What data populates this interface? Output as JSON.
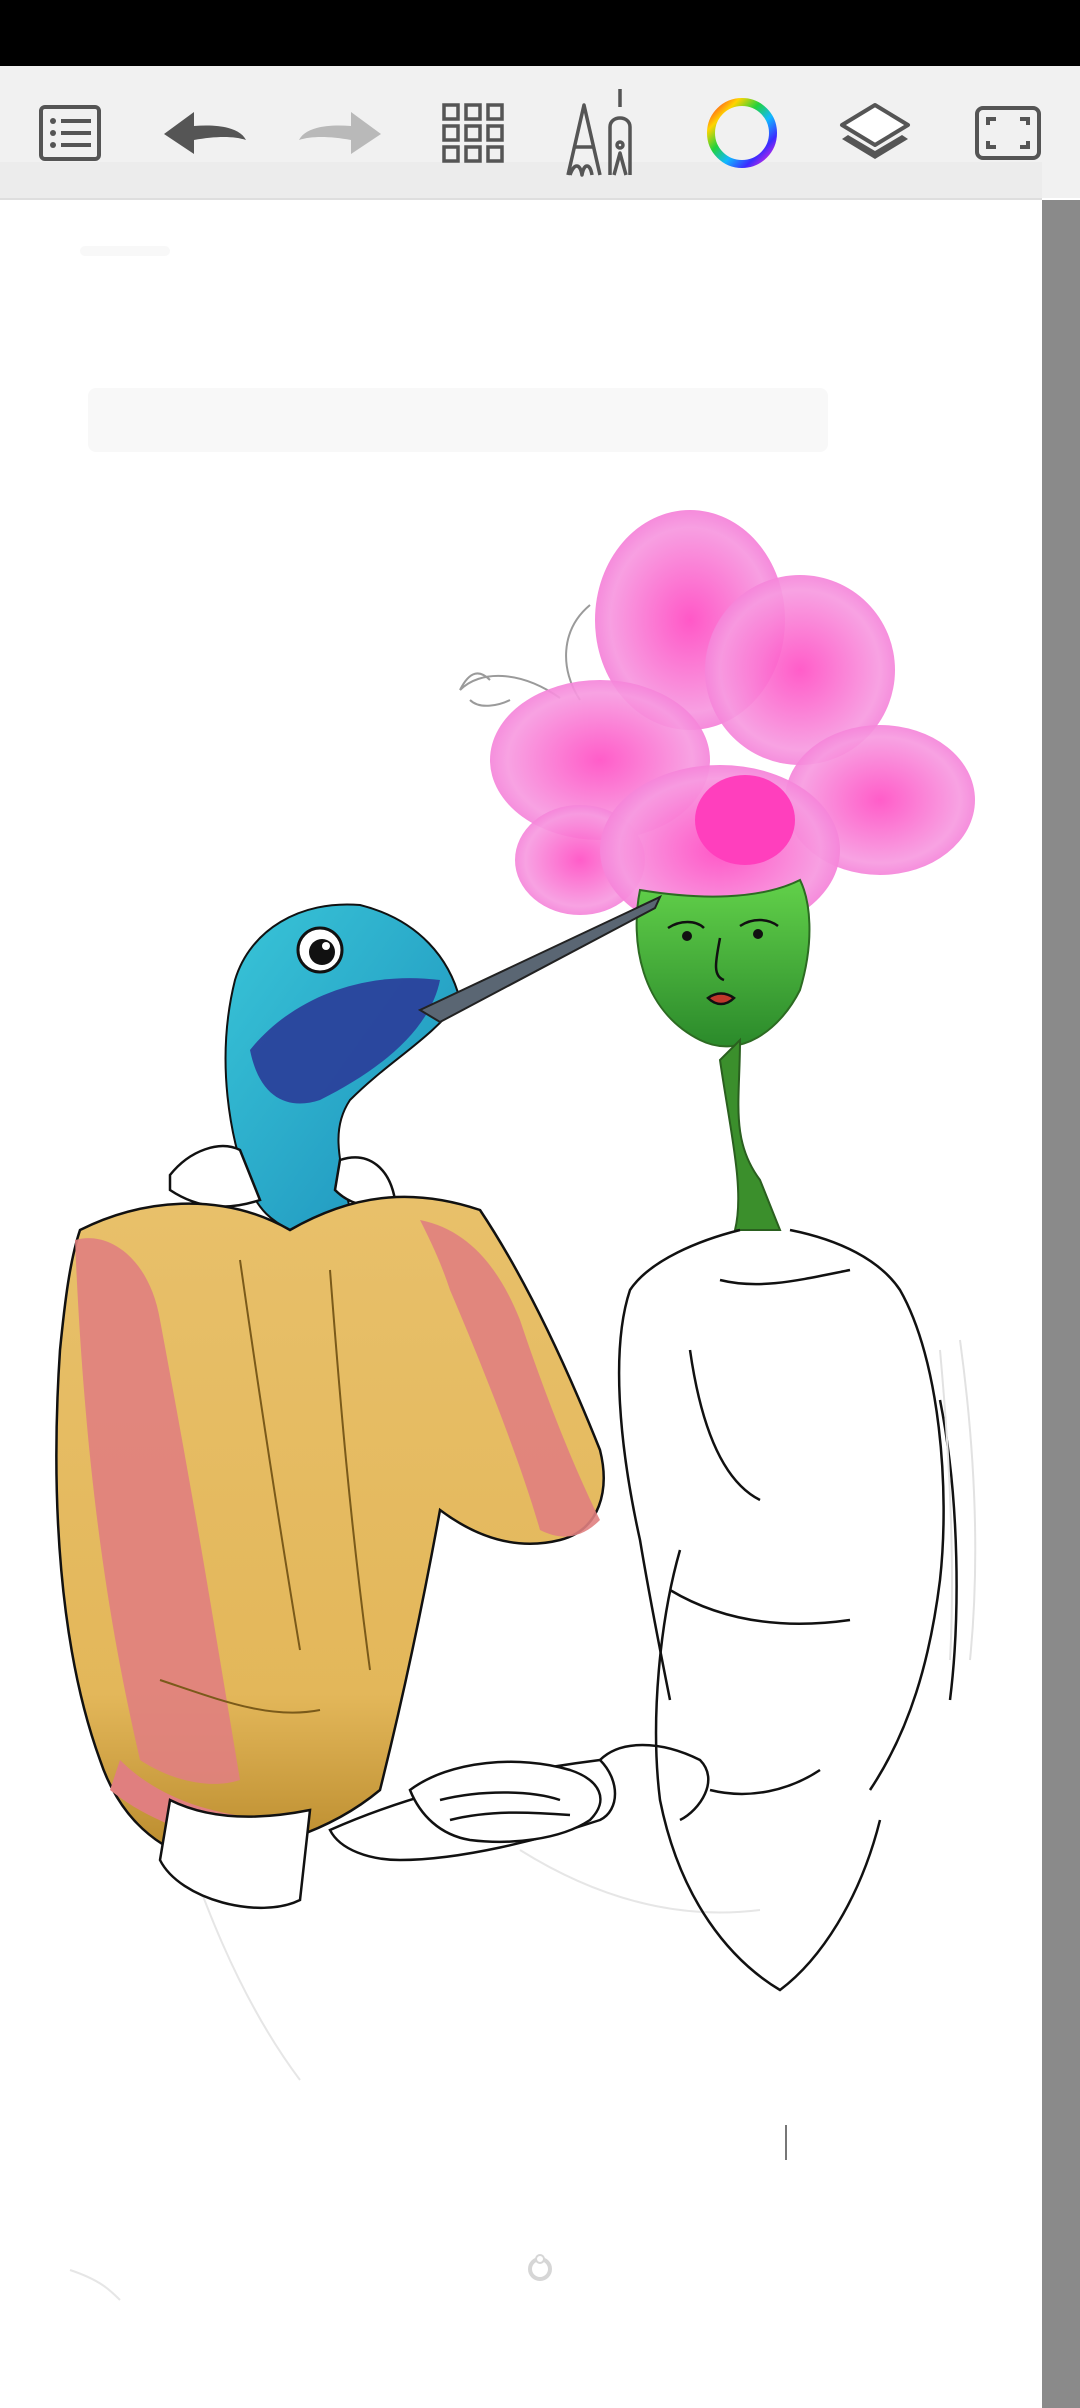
{
  "toolbar": {
    "items": [
      {
        "name": "menu-list",
        "icon": "list-icon"
      },
      {
        "name": "undo",
        "icon": "undo-arrow-icon"
      },
      {
        "name": "redo",
        "icon": "redo-arrow-icon"
      },
      {
        "name": "gallery",
        "icon": "grid-icon"
      },
      {
        "name": "brush-tools",
        "icon": "pencil-pen-icon"
      },
      {
        "name": "color-picker",
        "icon": "color-wheel-icon"
      },
      {
        "name": "layers",
        "icon": "layers-icon"
      },
      {
        "name": "fullscreen",
        "icon": "fullscreen-icon"
      }
    ]
  },
  "canvas": {
    "artwork": "hummingbird-and-flower-couple-drawing"
  },
  "colors": {
    "status_bar": "#000000",
    "toolbar_bg": "#f1f1f1",
    "icon_gray": "#555555",
    "icon_disabled": "#b9b9b9",
    "scrollbar": "#8a8a8a",
    "flower_pink": "#f07ad6",
    "stem_green": "#4caf34",
    "bird_teal": "#2ab3c9",
    "bird_blue": "#2a3f9a",
    "jacket_yellow": "#e6bd63",
    "stripe_pink": "#e08585"
  }
}
